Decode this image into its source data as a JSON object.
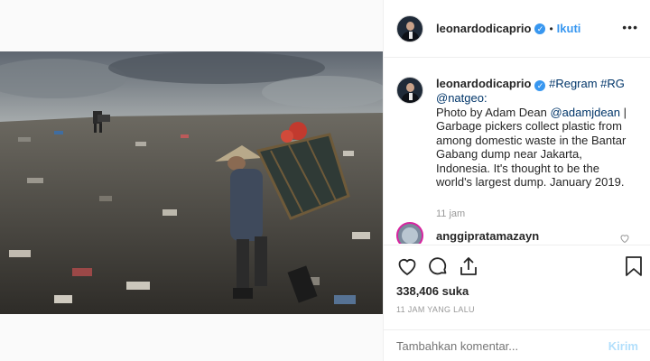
{
  "header": {
    "username": "leonardodicaprio",
    "separator": "•",
    "follow_label": "Ikuti",
    "more_label": "•••"
  },
  "caption": {
    "username": "leonardodicaprio",
    "hashtags": "#Regram #RG",
    "mention_line": "@natgeo:",
    "line1": "Photo by Adam Dean ",
    "mention_photographer": "@adamjdean",
    "line1_tail": " |",
    "body": "Garbage pickers collect plastic from among domestic waste in the Bantar Gabang dump near Jakarta, Indonesia. It's thought to be the world's largest dump. January 2019.",
    "time": "11 jam"
  },
  "comment": {
    "username": "anggipratamazayn"
  },
  "actions": {
    "likes": "338,406 suka",
    "posted_ago": "11 JAM YANG LALU"
  },
  "comment_box": {
    "placeholder": "Tambahkan komentar...",
    "send_label": "Kirim"
  },
  "icons": {
    "like": "heart-icon",
    "comment": "comment-icon",
    "share": "share-icon",
    "save": "bookmark-icon",
    "verified": "verified-badge-icon"
  },
  "colors": {
    "link": "#3897f0",
    "verified": "#3897f0",
    "muted": "#999999"
  }
}
